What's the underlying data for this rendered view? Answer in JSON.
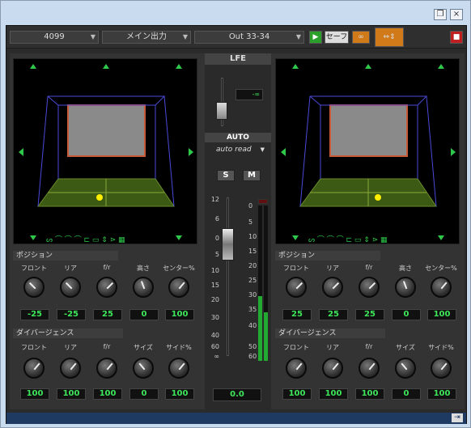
{
  "window": {
    "restore_glyph": "❐",
    "close_glyph": "×"
  },
  "toolbar": {
    "track": "4099",
    "output": "メイン出力",
    "channel": "Out 33-34",
    "save_label": "セーフ",
    "play_glyph": "▶"
  },
  "left": {
    "position_title": "ポジション",
    "position_labels": [
      "フロント",
      "リア",
      "f/r",
      "高さ",
      "センター%"
    ],
    "position_values": [
      "-25",
      "-25",
      "25",
      "0",
      "100"
    ],
    "divergence_title": "ダイバージェンス",
    "divergence_labels": [
      "フロント",
      "リア",
      "f/r",
      "サイズ",
      "サイド%"
    ],
    "divergence_values": [
      "100",
      "100",
      "100",
      "0",
      "100"
    ]
  },
  "right": {
    "position_title": "ポジション",
    "position_labels": [
      "フロント",
      "リア",
      "f/r",
      "高さ",
      "センター%"
    ],
    "position_values": [
      "25",
      "25",
      "25",
      "0",
      "100"
    ],
    "divergence_title": "ダイバージェンス",
    "divergence_labels": [
      "フロント",
      "リア",
      "f/r",
      "サイズ",
      "サイド%"
    ],
    "divergence_values": [
      "100",
      "100",
      "100",
      "0",
      "100"
    ]
  },
  "center": {
    "lfe_label": "LFE",
    "lfe_value": "-∞",
    "auto_label": "AUTO",
    "auto_mode": "auto read",
    "solo": "S",
    "mute": "M",
    "fader_scale": [
      "12",
      "6",
      "0",
      "5",
      "10",
      "15",
      "20",
      "30",
      "40",
      "60",
      "∞"
    ],
    "meter_scale": [
      "0",
      "5",
      "10",
      "15",
      "20",
      "25",
      "30",
      "35",
      "40",
      "50",
      "60"
    ],
    "fader_value": "0.0"
  },
  "colors": {
    "accent_green": "#3ee65a",
    "floor": "#3c5a14",
    "cube": "#4a4ad8",
    "screen": "#c85a3a"
  }
}
